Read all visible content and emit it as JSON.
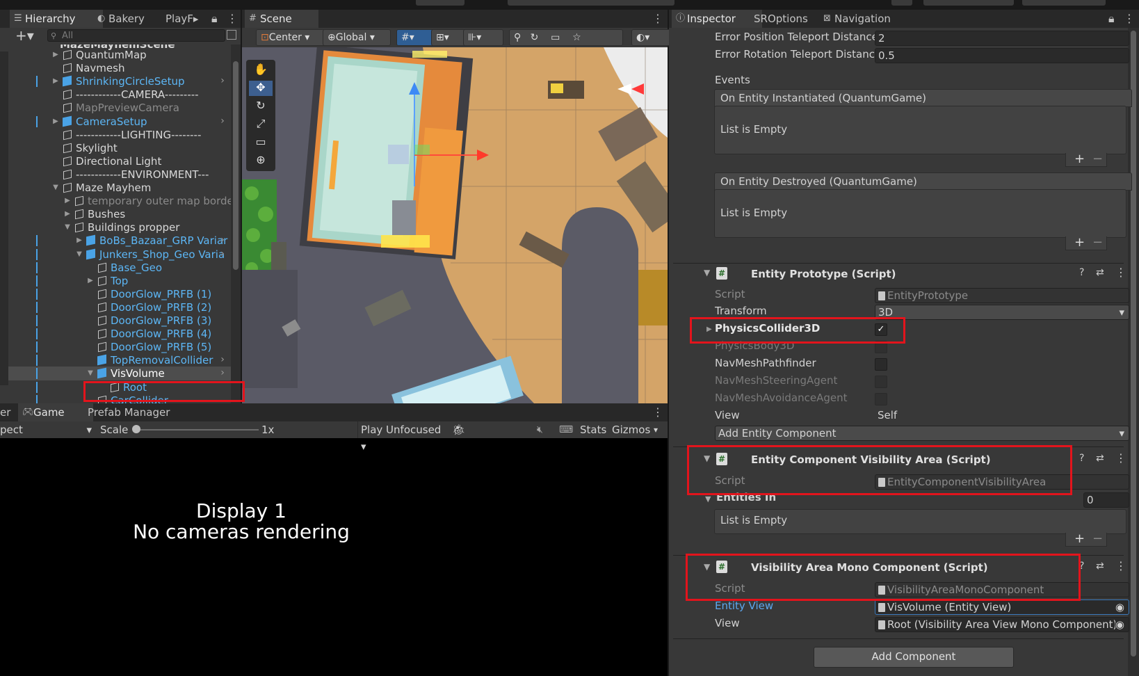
{
  "hierarchy": {
    "tabs": [
      "Hierarchy",
      "Bakery",
      "PlayF▸"
    ],
    "search_placeholder": "All",
    "scene_name": "MazeMayhemScene",
    "rows": [
      {
        "label": "QuantumMap",
        "indent": 0
      },
      {
        "label": "Navmesh",
        "indent": 0
      },
      {
        "label": "ShrinkingCircleSetup",
        "indent": 0
      },
      {
        "label": "------------CAMERA---------",
        "indent": 0
      },
      {
        "label": "MapPreviewCamera",
        "indent": 0
      },
      {
        "label": "CameraSetup",
        "indent": 0
      },
      {
        "label": "------------LIGHTING--------",
        "indent": 0
      },
      {
        "label": "Skylight",
        "indent": 0
      },
      {
        "label": "Directional Light",
        "indent": 0
      },
      {
        "label": "------------ENVIRONMENT---",
        "indent": 0
      },
      {
        "label": "Maze Mayhem",
        "indent": 0
      },
      {
        "label": "temporary outer map border",
        "indent": 1
      },
      {
        "label": "Bushes",
        "indent": 1
      },
      {
        "label": "Buildings propper",
        "indent": 1
      },
      {
        "label": "BoBs_Bazaar_GRP Variar",
        "indent": 2
      },
      {
        "label": "Junkers_Shop_Geo Varia",
        "indent": 2
      },
      {
        "label": "Base_Geo",
        "indent": 3
      },
      {
        "label": "Top",
        "indent": 3
      },
      {
        "label": "DoorGlow_PRFB (1)",
        "indent": 3
      },
      {
        "label": "DoorGlow_PRFB (2)",
        "indent": 3
      },
      {
        "label": "DoorGlow_PRFB (3)",
        "indent": 3
      },
      {
        "label": "DoorGlow_PRFB (4)",
        "indent": 3
      },
      {
        "label": "DoorGlow_PRFB (5)",
        "indent": 3
      },
      {
        "label": "TopRemovalCollider",
        "indent": 3
      },
      {
        "label": "VisVolume",
        "indent": 3
      },
      {
        "label": "Root",
        "indent": 4
      },
      {
        "label": "CarCollider",
        "indent": 3
      }
    ]
  },
  "scene": {
    "tab": "Scene",
    "pivot": "Center",
    "space": "Global"
  },
  "game": {
    "tabs": [
      "er",
      "Game",
      "Prefab Manager"
    ],
    "aspect": "pect",
    "scale_label": "Scale",
    "scale_value": "1x",
    "play_mode": "Play Unfocused",
    "stats": "Stats",
    "gizmos": "Gizmos",
    "display_line1": "Display 1",
    "display_line2": "No cameras rendering"
  },
  "inspector": {
    "tabs": [
      "Inspector",
      "SROptions",
      "Navigation"
    ],
    "error_pos_label": "Error Position Teleport Distance",
    "error_pos_value": "2",
    "error_rot_label": "Error Rotation Teleport Distance",
    "error_rot_value": "0.5",
    "events_label": "Events",
    "event1_header": "On Entity Instantiated (QuantumGame)",
    "event2_header": "On Entity Destroyed (QuantumGame)",
    "list_empty": "List is Empty",
    "plus": "+",
    "minus": "−",
    "comp1_title": "Entity Prototype (Script)",
    "script_label": "Script",
    "comp1_script": "EntityPrototype",
    "transform_label": "Transform",
    "transform_value": "3D",
    "physics3d_label": "PhysicsCollider3D",
    "physicsbody_label": "PhysicsBody3D",
    "navpath_label": "NavMeshPathfinder",
    "navsteer_label": "NavMeshSteeringAgent",
    "navavoid_label": "NavMeshAvoidanceAgent",
    "view_label": "View",
    "view_value": "Self",
    "add_entity_comp": "Add Entity Component",
    "comp2_title": "Entity Component Visibility Area (Script)",
    "comp2_script": "EntityComponentVisibilityArea",
    "entities_in_label": "Entities In",
    "entities_in_count": "0",
    "comp3_title": "Visibility Area Mono Component (Script)",
    "comp3_script": "VisibilityAreaMonoComponent",
    "entity_view_label": "Entity View",
    "entity_view_value": "VisVolume (Entity View)",
    "view2_label": "View",
    "view2_value": "Root (Visibility Area View Mono Component)",
    "add_component": "Add Component"
  },
  "colors": {
    "highlight_red": "#e3141c",
    "prefab_blue": "#5cb6f5"
  }
}
